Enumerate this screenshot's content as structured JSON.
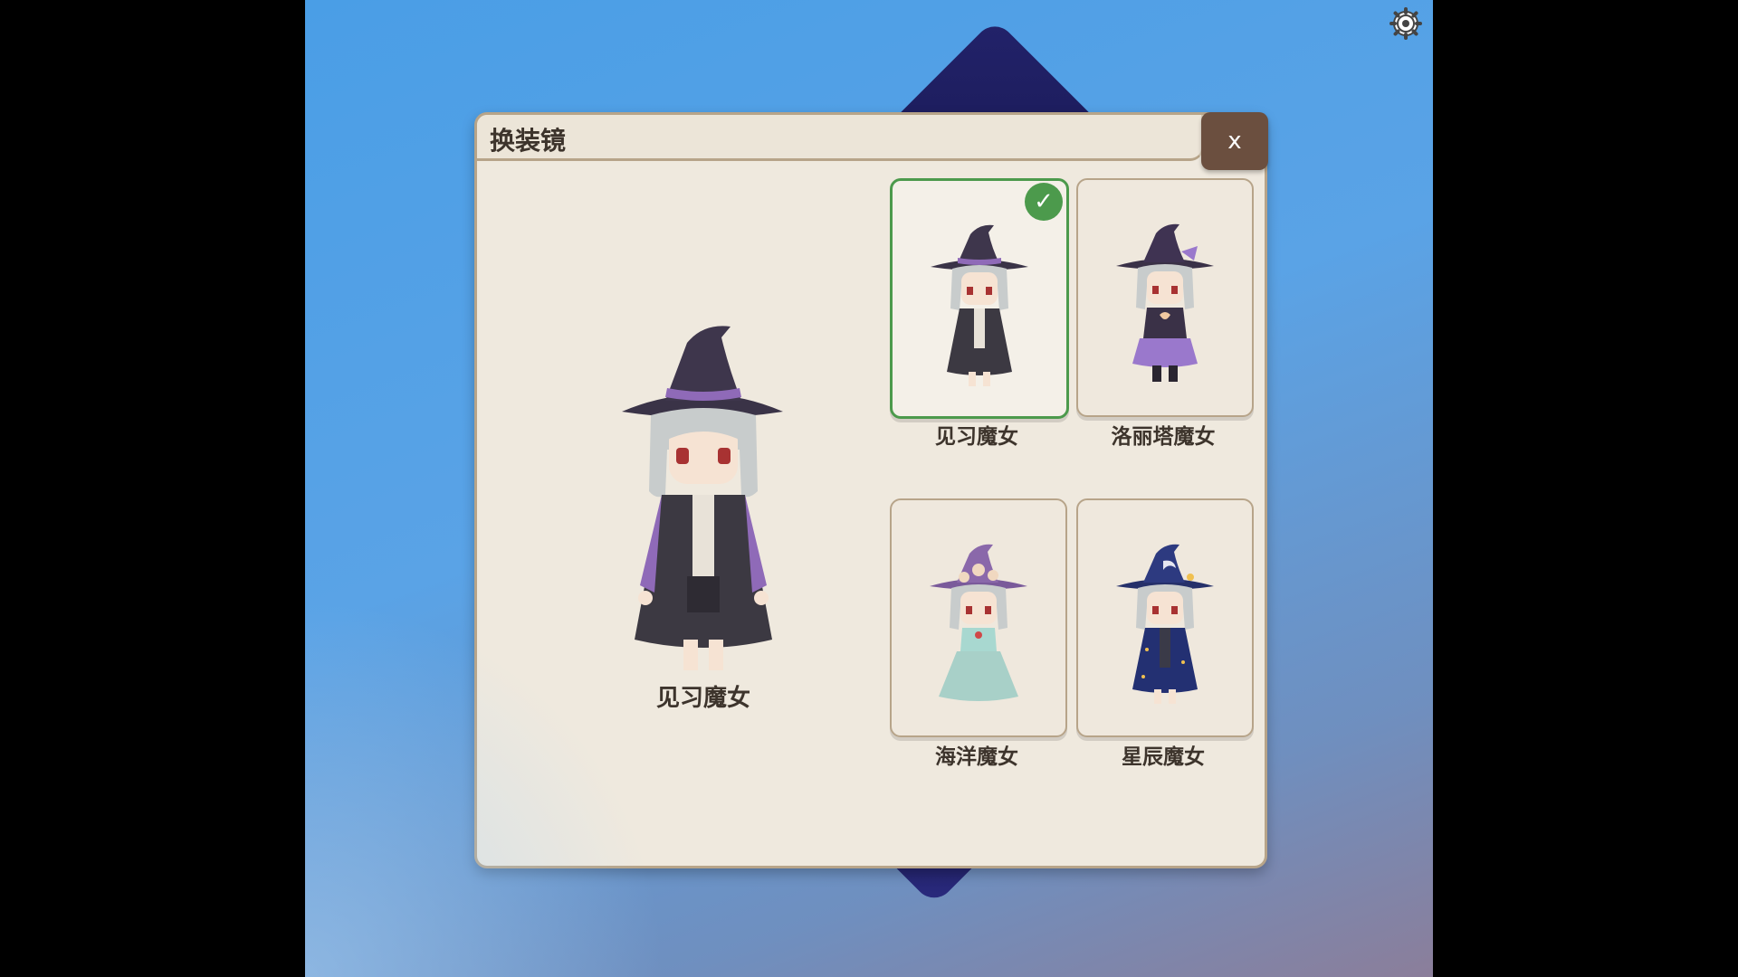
{
  "dialog": {
    "title": "换装镜",
    "close_label": "x"
  },
  "preview": {
    "name": "见习魔女"
  },
  "outfits": [
    {
      "name": "见习魔女",
      "selected": true,
      "check": "✓"
    },
    {
      "name": "洛丽塔魔女",
      "selected": false
    },
    {
      "name": "海洋魔女",
      "selected": false
    },
    {
      "name": "星辰魔女",
      "selected": false
    }
  ],
  "icons": {
    "settings": "gear-icon",
    "selected_marker": "checkmark-icon"
  },
  "colors": {
    "panel": "#efe9de",
    "close_button": "#6b4f3f",
    "selected_border": "#4c9a4c",
    "text": "#3d342c"
  }
}
